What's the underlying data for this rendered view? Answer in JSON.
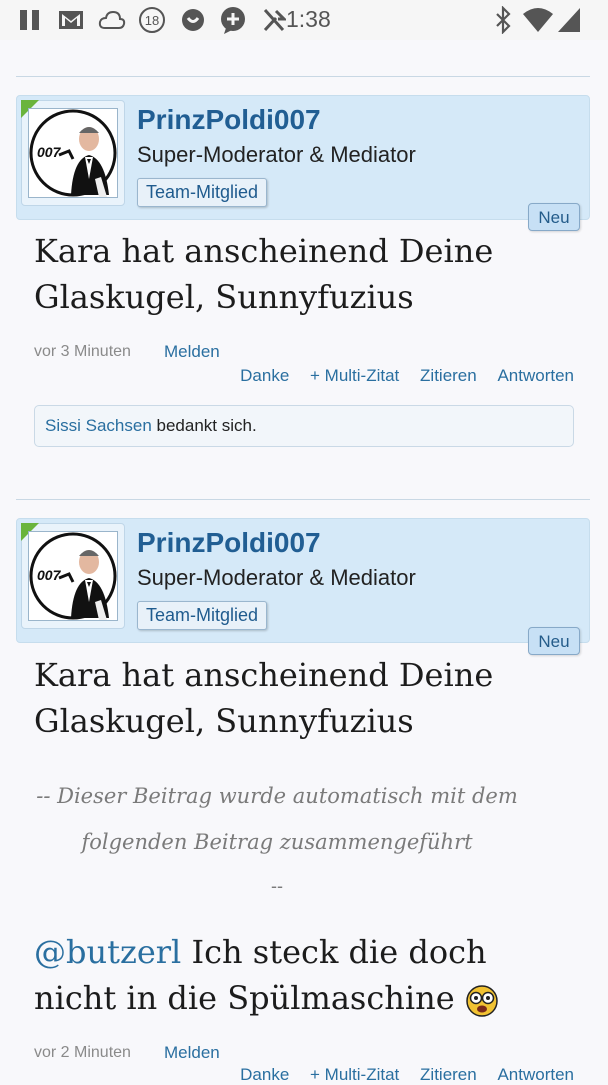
{
  "status_bar": {
    "time": "1:38",
    "notif_count": "18"
  },
  "posts": [
    {
      "username": "PrinzPoldi007",
      "user_title": "Super-Moderator & Mediator",
      "banner": "Team-Mitglied",
      "new_badge": "Neu",
      "message": "Kara hat anscheinend Deine Glaskugel, Sunnyfuzius",
      "time": "vor 3 Minuten",
      "report": "Melden",
      "actions": {
        "like": "Danke",
        "multiquote": "+ Multi-Zitat",
        "quote": "Zitieren",
        "reply": "Antworten"
      },
      "likes": {
        "liker": "Sissi Sachsen",
        "text": "bedankt sich."
      }
    },
    {
      "username": "PrinzPoldi007",
      "user_title": "Super-Moderator & Mediator",
      "banner": "Team-Mitglied",
      "new_badge": "Neu",
      "message": "Kara hat anscheinend Deine Glaskugel, Sunnyfuzius",
      "merge_notice": "-- Dieser Beitrag wurde automatisch mit dem folgenden Beitrag zusammengeführt",
      "merge_end": "--",
      "mention": "@butzerl",
      "message2": "Ich steck die doch nicht in die Spülmaschine",
      "time": "vor 2 Minuten",
      "report": "Melden",
      "actions": {
        "like": "Danke",
        "multiquote": "+ Multi-Zitat",
        "quote": "Zitieren",
        "reply": "Antworten"
      }
    }
  ],
  "icons": [
    "pause-icon",
    "gmail-icon",
    "cloud-icon",
    "badge-18-icon",
    "refresh-icon",
    "add-chat-icon",
    "no-signal-icon",
    "bluetooth-icon",
    "wifi-icon",
    "cell-signal-icon"
  ]
}
